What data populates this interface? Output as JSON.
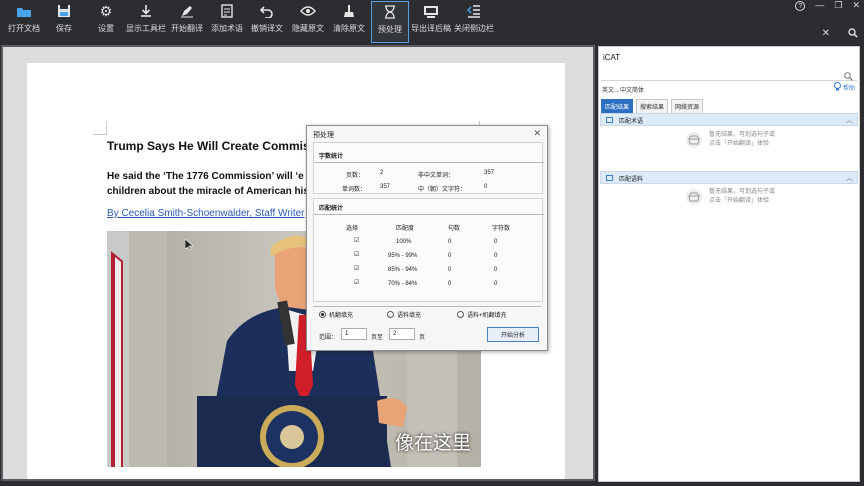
{
  "toolbar": {
    "buttons": [
      {
        "label": "打开文档",
        "icon": "folder-icon"
      },
      {
        "label": "保存",
        "icon": "save-icon"
      },
      {
        "label": "设置",
        "icon": "gear-icon"
      },
      {
        "label": "显示工具栏",
        "icon": "download-icon"
      },
      {
        "label": "开始翻译",
        "icon": "pen-icon"
      },
      {
        "label": "添加术语",
        "icon": "add-term-icon"
      },
      {
        "label": "撤销译文",
        "icon": "undo-icon"
      },
      {
        "label": "隐藏原文",
        "icon": "eye-icon"
      },
      {
        "label": "清除原文",
        "icon": "broom-icon"
      },
      {
        "label": "预处理",
        "icon": "hourglass-icon"
      },
      {
        "label": "导出译后稿",
        "icon": "export-icon"
      },
      {
        "label": "关闭侧边栏",
        "icon": "close-sidebar-icon"
      }
    ],
    "active": "预处理"
  },
  "window_controls": {
    "help": "?",
    "minimize": "—",
    "restore": "❐",
    "close": "✕"
  },
  "sidebar_controls": {
    "close": "✕",
    "search": "search-icon"
  },
  "document": {
    "title": "Trump Says He Will Create Commission",
    "body_line1": "He said the ‘The 1776 Commission’ will ‘e",
    "body_line2": "children about the miracle of American histo",
    "byline": "By Cecelia Smith-Schoenwalder, Staff Writer",
    "video_subtitle": "像在这里"
  },
  "side_panel": {
    "title": "iCAT",
    "search_placeholder": "",
    "language_pair": "英文→中文简体",
    "help_label": "帮助",
    "tabs": [
      "匹配结果",
      "搜索结果",
      "网络资源"
    ],
    "active_tab": "匹配结果",
    "sections": [
      {
        "title": "匹配术语",
        "empty_line1": "暂无结果，可划选句子或",
        "empty_line2": "点击「开始翻译」体验"
      },
      {
        "title": "匹配语料",
        "empty_line1": "暂无结果，可划选句子或",
        "empty_line2": "点击「开始翻译」体验"
      }
    ]
  },
  "dialog": {
    "title": "预处理",
    "close": "✕",
    "word_stats": {
      "heading": "字数统计",
      "pages_label": "页数：",
      "pages_value": "2",
      "non_cn_label": "非中文单词：",
      "non_cn_value": "357",
      "words_label": "单词数：",
      "words_value": "357",
      "cn_label": "中（朝）文字符：",
      "cn_value": "0"
    },
    "match_stats": {
      "heading": "匹配统计",
      "columns": [
        "选择",
        "匹配度",
        "句数",
        "字符数"
      ],
      "rows": [
        {
          "checked": true,
          "match": "100%",
          "sentences": "0",
          "chars": "0"
        },
        {
          "checked": true,
          "match": "95% - 99%",
          "sentences": "0",
          "chars": "0"
        },
        {
          "checked": true,
          "match": "85% - 94%",
          "sentences": "0",
          "chars": "0"
        },
        {
          "checked": true,
          "match": "70% - 84%",
          "sentences": "0",
          "chars": "0"
        }
      ]
    },
    "fill_options": [
      "机翻填充",
      "语料填充",
      "语料+机翻填充"
    ],
    "fill_selected": "机翻填充",
    "range_label": "范围：",
    "range_from": "1",
    "page_to_label": "页至",
    "range_to": "2",
    "page_label": "页",
    "analyze_button": "开始分析"
  },
  "colors": {
    "toolbar_bg": "#2b2d31",
    "accent": "#2d6fc0",
    "link": "#2a57b5"
  }
}
